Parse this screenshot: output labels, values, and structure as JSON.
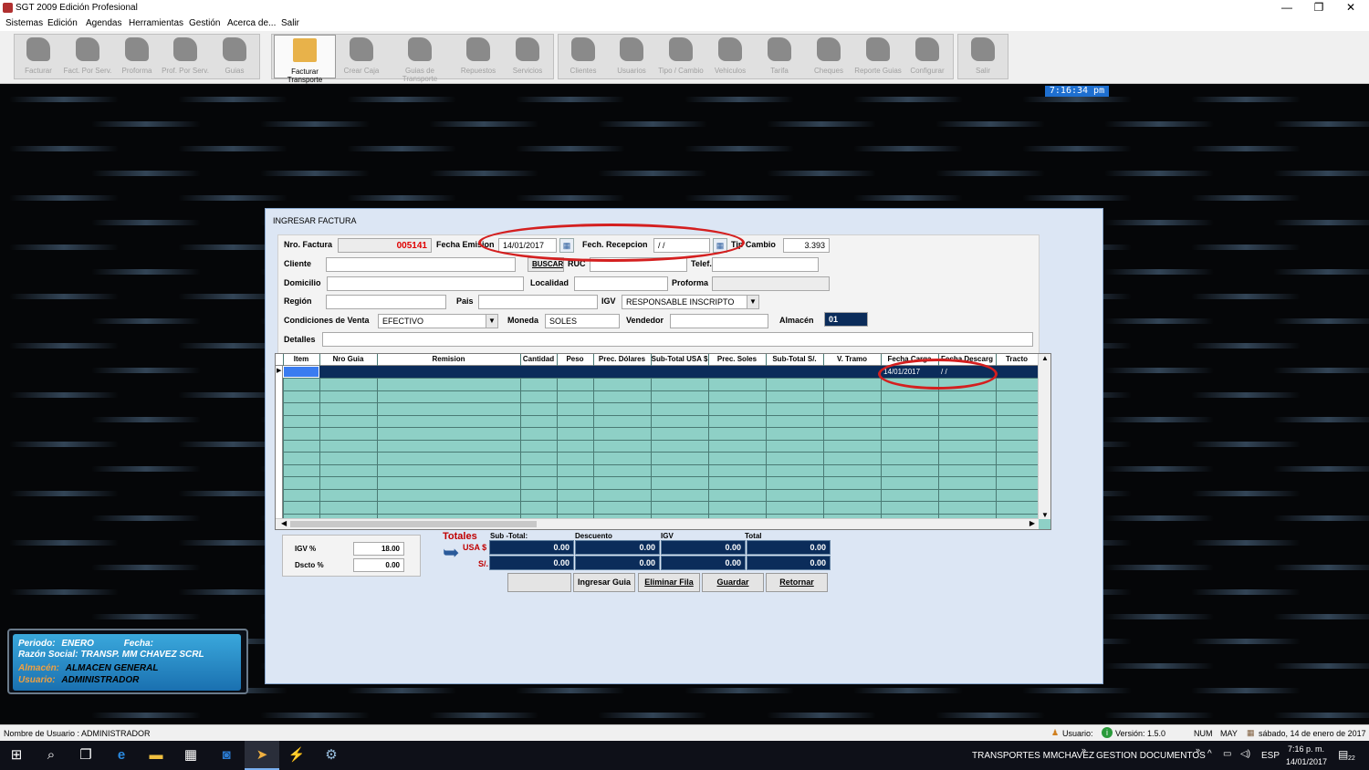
{
  "window": {
    "title": "SGT 2009 Edición Profesional",
    "minimize": "—",
    "restore": "❐",
    "close": "✕"
  },
  "menu": [
    "Sistemas",
    "Edición",
    "Agendas",
    "Herramientas",
    "Gestión",
    "Acerca de...",
    "Salir"
  ],
  "toolbar": {
    "buttons": [
      "Facturar",
      "Fact. Por Serv.",
      "Proforma",
      "Prof. Por Serv.",
      "Guias",
      "Facturar Transporte",
      "Crear Caja",
      "Guias de Transporte",
      "Repuestos",
      "Servicios",
      "Clientes",
      "Usuarios",
      "Tipo / Cambio",
      "Vehiculos",
      "Tarifa",
      "Cheques",
      "Reporte Guias",
      "Configurar",
      "Salir"
    ],
    "active": "Facturar Transporte"
  },
  "clock": "7:16:34 pm",
  "dialog": {
    "title": "INGRESAR FACTURA",
    "nro_factura_label": "Nro. Factura",
    "nro_factura": "005141",
    "fecha_emision_label": "Fecha Emision",
    "fecha_emision": "14/01/2017",
    "fecha_recepcion_label": "Fech. Recepcion",
    "fecha_recepcion": "/ /",
    "tipo_cambio_label": "Tip Cambio",
    "tipo_cambio": "3.393",
    "cliente_label": "Cliente",
    "buscar_label": "BUSCAR",
    "ruc_label": "RUC",
    "telef_label": "Telef.",
    "domicilio_label": "Domicilio",
    "localidad_label": "Localidad",
    "proforma_label": "Proforma",
    "region_label": "Región",
    "pais_label": "Pais",
    "igv_label": "IGV",
    "igv_value": "RESPONSABLE INSCRIPTO",
    "condiciones_label": "Condiciones de Venta",
    "condiciones_value": "EFECTIVO",
    "moneda_label": "Moneda",
    "moneda_value": "SOLES",
    "vendedor_label": "Vendedor",
    "almacen_label": "Almacén",
    "almacen_value": "01",
    "detalles_label": "Detalles",
    "grid": {
      "columns": [
        "Item",
        "Nro Guia",
        "Remision",
        "Cantidad",
        "Peso",
        "Prec. Dólares",
        "Sub-Total USA $",
        "Prec. Soles",
        "Sub-Total S/.",
        "V. Tramo",
        "Fecha Carga",
        "Fecha Descarg",
        "Tracto"
      ],
      "row1_fecha_carga": "14/01/2017",
      "row1_fecha_descarga": "/ /"
    },
    "igv_pct_label": "IGV %",
    "igv_pct": "18.00",
    "dscto_label": "Dscto %",
    "dscto": "0.00",
    "totales_label": "Totales",
    "subtotal_label": "Sub -Total:",
    "descuento_label": "Descuento",
    "igv_col_label": "IGV",
    "total_label": "Total",
    "usd_label": "USA $",
    "soles_label": "S/.",
    "usd_values": [
      "0.00",
      "0.00",
      "0.00",
      "0.00"
    ],
    "soles_values": [
      "0.00",
      "0.00",
      "0.00",
      "0.00"
    ],
    "buttons": {
      "blank": "",
      "ingresar": "Ingresar Guia",
      "eliminar": "Eliminar Fila",
      "guardar": "Guardar",
      "retornar": "Retornar"
    }
  },
  "info_panel": {
    "periodo_label": "Periodo:",
    "periodo": "ENERO",
    "fecha_label": "Fecha:",
    "razon_label": "Razón Social:",
    "razon": "TRANSP. MM CHAVEZ SCRL",
    "almacen_label": "Almacén:",
    "almacen": "ALMACEN GENERAL",
    "usuario_label": "Usuario:",
    "usuario": "ADMINISTRADOR"
  },
  "statusbar": {
    "left": "Nombre de Usuario : ADMINISTRADOR",
    "usuario": "Usuario:",
    "version": "Versión: 1.5.0",
    "num": "NUM",
    "may": "MAY",
    "date": "sábado, 14 de enero de 2017"
  },
  "taskbar": {
    "item1": "TRANSPORTES MMCHAVEZ",
    "item2": "GESTION DOCUMENTOS",
    "lang": "ESP",
    "time": "7:16 p. m.",
    "date": "14/01/2017",
    "notif": "22"
  },
  "colors": {
    "highlight_oval": "#d41f1f",
    "grid_bg": "#8ed0c6",
    "selected_row": "#0b2c5a",
    "invoice_number": "#e00000"
  }
}
